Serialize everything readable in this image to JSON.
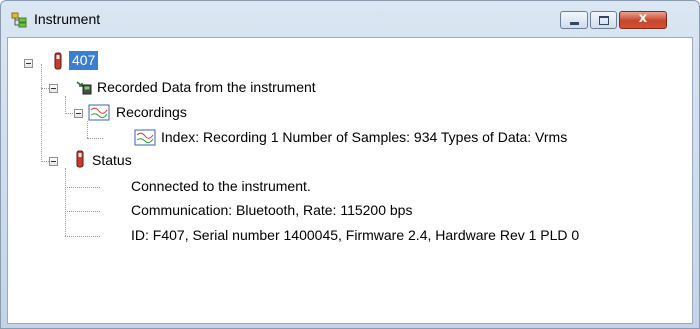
{
  "window": {
    "title": "Instrument",
    "close_label": "x"
  },
  "tree": {
    "root_label": "407",
    "recorded_data_label": "Recorded Data from the instrument",
    "recordings_label": "Recordings",
    "recording_item_label": "Index: Recording 1 Number of Samples: 934 Types of Data: Vrms",
    "status_label": "Status",
    "status_items": [
      "Connected to the instrument.",
      "Communication: Bluetooth, Rate: 115200 bps",
      "ID: F407, Serial number 1400045, Firmware 2.4, Hardware Rev 1 PLD 0"
    ]
  },
  "colors": {
    "selection": "#3a7ed4",
    "window_frame": "#c4d4e8",
    "close_button": "#c7452c"
  }
}
